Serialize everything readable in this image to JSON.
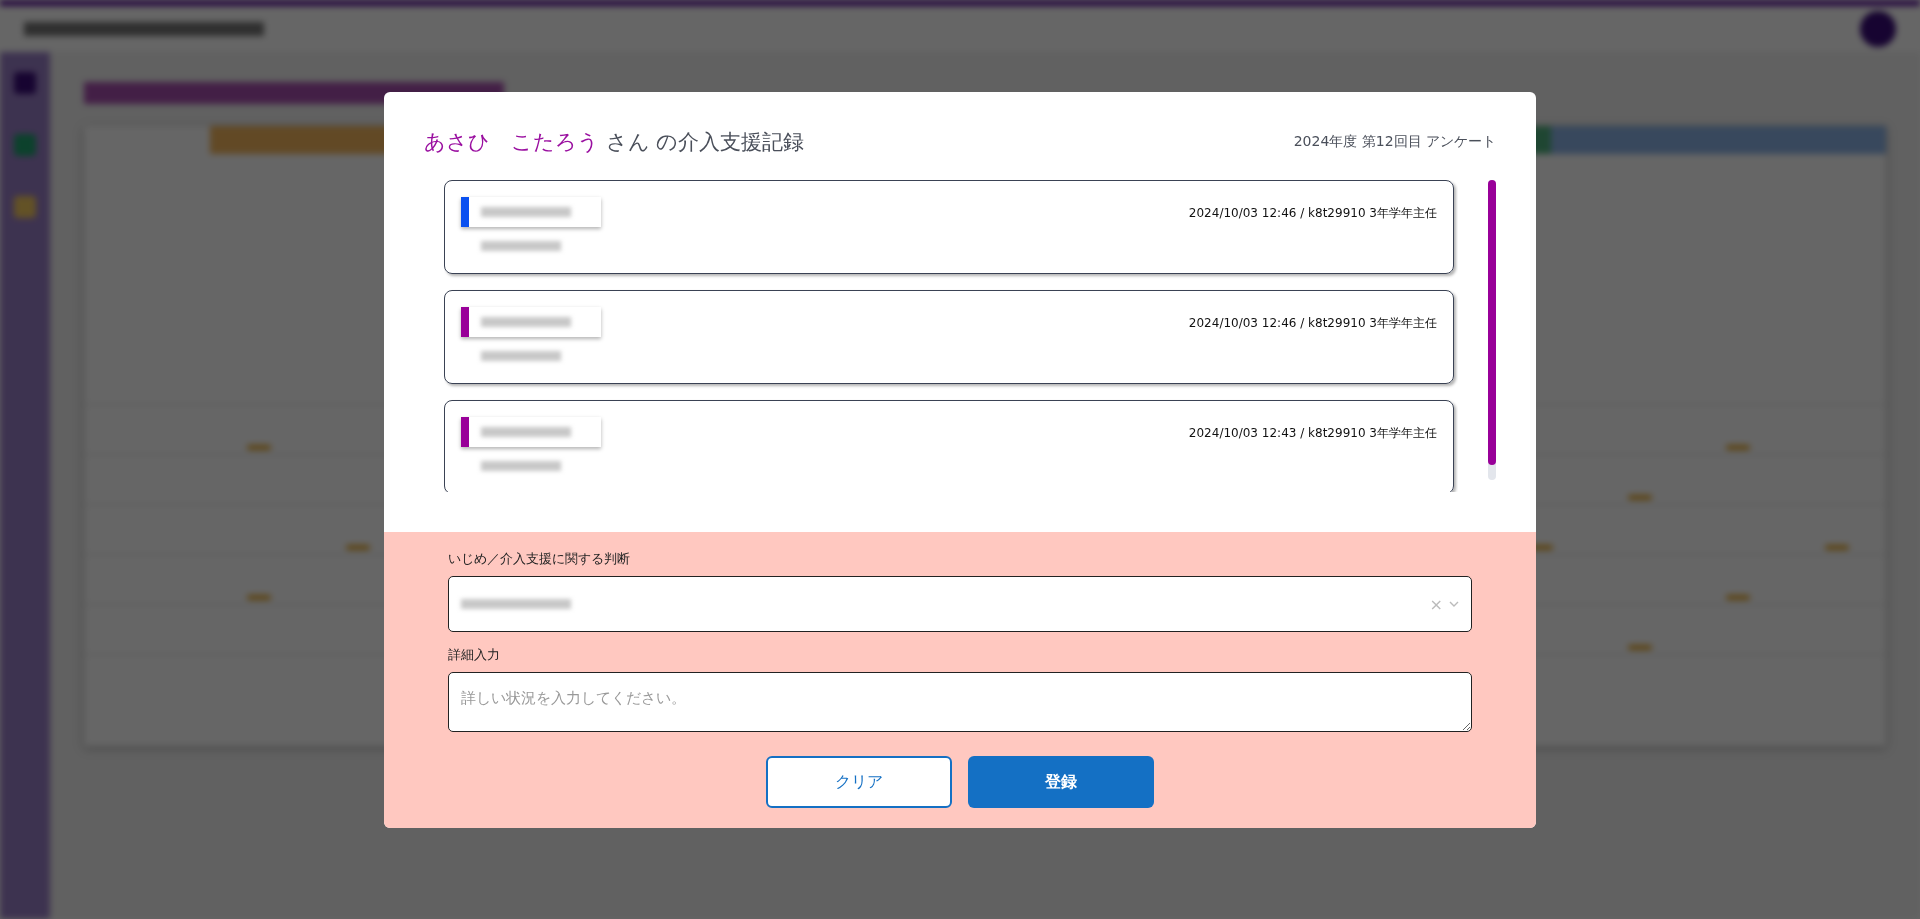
{
  "dialog": {
    "student_name": "あさひ　こたろう",
    "title_suffix": "さん の介入支援記録",
    "survey": "2024年度 第12回目 アンケート",
    "records": [
      {
        "color": "#0a50f0",
        "timestamp": "2024/10/03 12:46 / k8t29910 3年学年主任"
      },
      {
        "color": "#990099",
        "timestamp": "2024/10/03 12:46 / k8t29910 3年学年主任"
      },
      {
        "color": "#990099",
        "timestamp": "2024/10/03 12:43 / k8t29910 3年学年主任"
      }
    ],
    "judgement": {
      "label": "いじめ／介入支援に関する判断",
      "clear": "×"
    },
    "detail": {
      "label": "詳細入力",
      "placeholder": "詳しい状況を入力してください。"
    },
    "buttons": [
      {
        "kind": "secondary",
        "label": "クリア"
      },
      {
        "kind": "primary",
        "label": "登録"
      }
    ]
  }
}
